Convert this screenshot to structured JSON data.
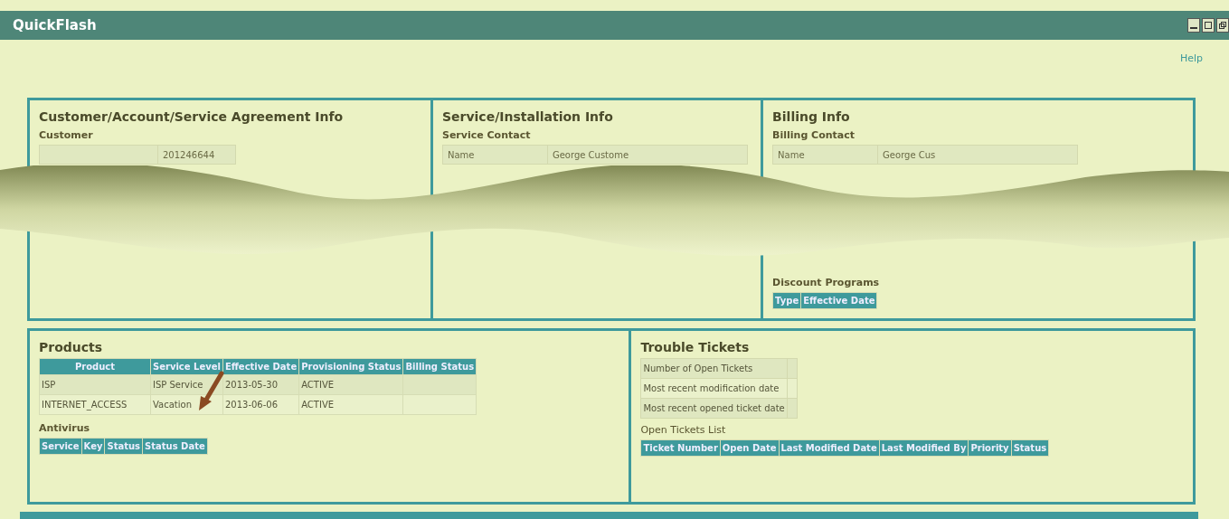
{
  "window": {
    "title": "QuickFlash"
  },
  "help_link": "Help",
  "info_panels": [
    {
      "title": "Customer/Account/Service Agreement Info",
      "subtitle": "Customer",
      "rows": [
        {
          "value": "201246644"
        }
      ]
    },
    {
      "title": "Service/Installation Info",
      "subtitle": "Service Contact",
      "rows": [
        {
          "label": "Name",
          "value": "George Custome"
        }
      ]
    },
    {
      "title": "Billing Info",
      "subtitle": "Billing Contact",
      "rows": [
        {
          "label": "Name",
          "value": "George Cus"
        }
      ],
      "discount": {
        "title": "Discount Programs",
        "columns": [
          "Type",
          "Effective Date"
        ]
      }
    }
  ],
  "products": {
    "title": "Products",
    "columns": [
      "Product",
      "Service Level",
      "Effective Date",
      "Provisioning Status",
      "Billing Status"
    ],
    "rows": [
      [
        "ISP",
        "ISP Service",
        "2013-05-30",
        "ACTIVE"
      ],
      [
        "INTERNET_ACCESS",
        "Vacation",
        "2013-06-06",
        "ACTIVE"
      ]
    ],
    "antivirus": {
      "title": "Antivirus",
      "columns": [
        "Service",
        "Key",
        "Status",
        "Status Date"
      ]
    }
  },
  "trouble_tickets": {
    "title": "Trouble Tickets",
    "summary": [
      "Number of Open Tickets",
      "Most recent modification date",
      "Most recent opened ticket date"
    ],
    "list_title": "Open Tickets List",
    "columns": [
      "Ticket Number",
      "Open Date",
      "Last Modified Date",
      "Last Modified By",
      "Priority",
      "Status"
    ]
  }
}
